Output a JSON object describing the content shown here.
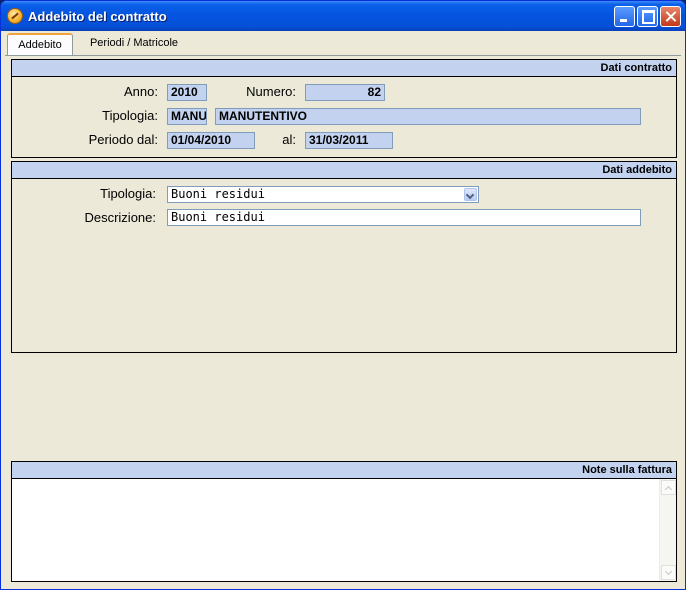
{
  "window": {
    "title": "Addebito del contratto"
  },
  "tabs": [
    {
      "label": "Addebito",
      "active": true
    },
    {
      "label": "Periodi / Matricole",
      "active": false
    }
  ],
  "dati_contratto": {
    "header": "Dati contratto",
    "anno_label": "Anno:",
    "anno_value": "2010",
    "numero_label": "Numero:",
    "numero_value": "82",
    "tipologia_label": "Tipologia:",
    "tipologia_code": "MANU",
    "tipologia_desc": "MANUTENTIVO",
    "periodo_dal_label": "Periodo dal:",
    "periodo_dal_value": "01/04/2010",
    "al_label": "al:",
    "al_value": "31/03/2011"
  },
  "dati_addebito": {
    "header": "Dati addebito",
    "tipologia_label": "Tipologia:",
    "tipologia_selected": "Buoni residui",
    "descrizione_label": "Descrizione:",
    "descrizione_value": "Buoni residui"
  },
  "note_fattura": {
    "header": "Note sulla fattura",
    "value": ""
  },
  "icons": {
    "app": "app-icon",
    "minimize": "minimize-icon",
    "maximize": "maximize-icon",
    "close": "close-icon",
    "dropdown": "chevron-down-icon"
  },
  "colors": {
    "titlebar": "#0554e0",
    "group_header": "#c3d3ef",
    "readonly_field": "#c3d3ef",
    "window_bg": "#ece9d8"
  }
}
